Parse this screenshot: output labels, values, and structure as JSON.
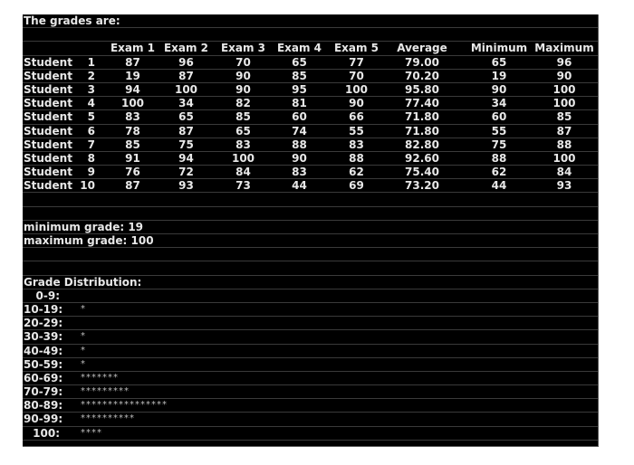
{
  "title": "The grades are:",
  "table": {
    "headers": [
      "Exam 1",
      "Exam 2",
      "Exam 3",
      "Exam 4",
      "Exam 5",
      "Average",
      "Minimum",
      "Maximum"
    ],
    "rows": [
      {
        "label": "Student",
        "num": "1",
        "values": [
          "87",
          "96",
          "70",
          "65",
          "77",
          "79.00",
          "65",
          "96"
        ]
      },
      {
        "label": "Student",
        "num": "2",
        "values": [
          "19",
          "87",
          "90",
          "85",
          "70",
          "70.20",
          "19",
          "90"
        ]
      },
      {
        "label": "Student",
        "num": "3",
        "values": [
          "94",
          "100",
          "90",
          "95",
          "100",
          "95.80",
          "90",
          "100"
        ]
      },
      {
        "label": "Student",
        "num": "4",
        "values": [
          "100",
          "34",
          "82",
          "81",
          "90",
          "77.40",
          "34",
          "100"
        ]
      },
      {
        "label": "Student",
        "num": "5",
        "values": [
          "83",
          "65",
          "85",
          "60",
          "66",
          "71.80",
          "60",
          "85"
        ]
      },
      {
        "label": "Student",
        "num": "6",
        "values": [
          "78",
          "87",
          "65",
          "74",
          "55",
          "71.80",
          "55",
          "87"
        ]
      },
      {
        "label": "Student",
        "num": "7",
        "values": [
          "85",
          "75",
          "83",
          "88",
          "83",
          "82.80",
          "75",
          "88"
        ]
      },
      {
        "label": "Student",
        "num": "8",
        "values": [
          "91",
          "94",
          "100",
          "90",
          "88",
          "92.60",
          "88",
          "100"
        ]
      },
      {
        "label": "Student",
        "num": "9",
        "values": [
          "76",
          "72",
          "84",
          "83",
          "62",
          "75.40",
          "62",
          "84"
        ]
      },
      {
        "label": "Student",
        "num": "10",
        "values": [
          "87",
          "93",
          "73",
          "44",
          "69",
          "73.20",
          "44",
          "93"
        ]
      }
    ]
  },
  "summary": {
    "min_line": "minimum grade: 19",
    "max_line": "maximum grade: 100"
  },
  "distribution": {
    "title": "Grade Distribution:",
    "bins": [
      {
        "label": "0-9:",
        "count": 0,
        "stars": ""
      },
      {
        "label": "10-19:",
        "count": 1,
        "stars": "*"
      },
      {
        "label": "20-29:",
        "count": 0,
        "stars": ""
      },
      {
        "label": "30-39:",
        "count": 1,
        "stars": "*"
      },
      {
        "label": "40-49:",
        "count": 1,
        "stars": "*"
      },
      {
        "label": "50-59:",
        "count": 1,
        "stars": "*"
      },
      {
        "label": "60-69:",
        "count": 7,
        "stars": "*******"
      },
      {
        "label": "70-79:",
        "count": 9,
        "stars": "*********"
      },
      {
        "label": "80-89:",
        "count": 16,
        "stars": "****************"
      },
      {
        "label": "90-99:",
        "count": 10,
        "stars": "**********"
      },
      {
        "label": "100:",
        "count": 4,
        "stars": "****"
      }
    ]
  }
}
